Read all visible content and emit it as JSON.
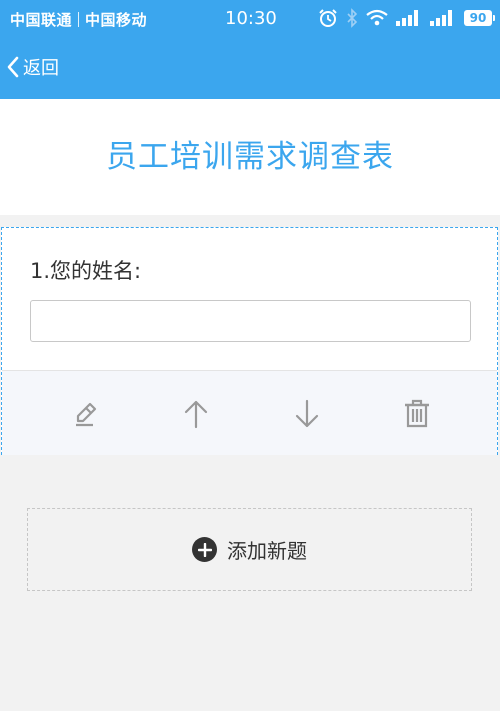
{
  "status_bar": {
    "carrier1": "中国联通",
    "carrier2": "中国移动",
    "time": "10:30",
    "battery": "90",
    "icons": [
      "alarm-icon",
      "bluetooth-icon",
      "wifi-icon",
      "signal-icon",
      "signal-icon",
      "battery-icon"
    ]
  },
  "nav": {
    "back_label": "返回"
  },
  "form": {
    "title": "员工培训需求调查表"
  },
  "question": {
    "label": "1.您的姓名:",
    "answer_value": "",
    "tools": [
      "edit-icon",
      "move-up-icon",
      "move-down-icon",
      "delete-icon"
    ]
  },
  "add_question": {
    "label": "添加新题"
  },
  "colors": {
    "primary": "#3ba6ee",
    "background": "#f2f2f2",
    "text": "#333333",
    "tool_icon": "#999999"
  }
}
